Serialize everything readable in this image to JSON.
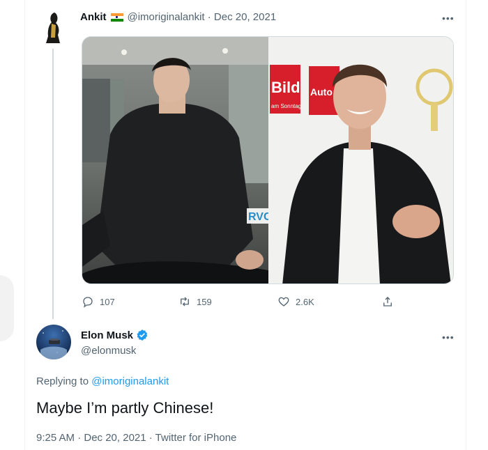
{
  "quoted_tweet": {
    "display_name": "Ankit",
    "meta": "@imoriginalankit · Dec 20, 2021",
    "flag": "india-flag-icon",
    "image_watermark": "RVCJ",
    "left_sign_text": "Bild",
    "left_sign_sub": "am Sonntag",
    "right_sign_text": "Auto Bild",
    "actions": {
      "replies": "107",
      "retweets": "159",
      "likes": "2.6K"
    }
  },
  "main_tweet": {
    "display_name": "Elon Musk",
    "handle": "@elonmusk",
    "replying_prefix": "Replying to",
    "replying_to": "@imoriginalankit",
    "text": "Maybe I’m partly Chinese!",
    "meta": "9:25 AM · Dec 20, 2021 · Twitter for iPhone"
  },
  "colors": {
    "accent_blue": "#1d9bf0",
    "secondary_text": "#536471",
    "primary_text": "#0f1419",
    "border": "#cfd9de"
  },
  "icons": [
    "more-icon",
    "reply-icon",
    "retweet-icon",
    "like-icon",
    "share-icon",
    "verified-icon"
  ]
}
